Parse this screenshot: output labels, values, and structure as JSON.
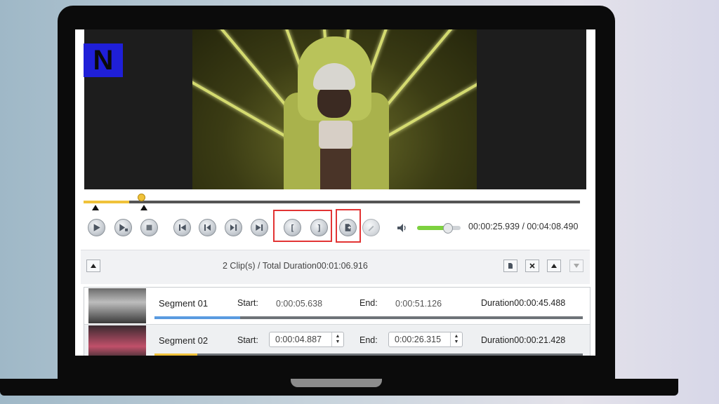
{
  "player": {
    "time_readout": "00:00:25.939 / 00:04:08.490",
    "controls": [
      "play",
      "play-segment",
      "stop",
      "previous",
      "step-back",
      "step-forward",
      "next",
      "set-start",
      "set-end",
      "add-segment",
      "edit"
    ],
    "start_bracket": "[",
    "end_bracket": "]",
    "volume_level": 0.7,
    "playhead_fraction": 0.11
  },
  "clip_list": {
    "summary": "2 Clip(s) / Total Duration00:01:06.916",
    "segments": [
      {
        "name": "Segment 01",
        "start_label": "Start:",
        "start": "0:00:05.638",
        "end_label": "End:",
        "end": "0:00:51.126",
        "duration": "Duration00:00:45.488",
        "progress": 0.2
      },
      {
        "name": "Segment 02",
        "start_label": "Start:",
        "start": "0:00:04.887",
        "end_label": "End:",
        "end": "0:00:26.315",
        "duration": "Duration00:00:21.428",
        "progress": 0.1
      }
    ]
  },
  "colors": {
    "highlight": "#e23434",
    "timeline_fill": "#f0c23a",
    "volume_fill": "#7dd13f",
    "segment_progress": "#5a9be0"
  }
}
